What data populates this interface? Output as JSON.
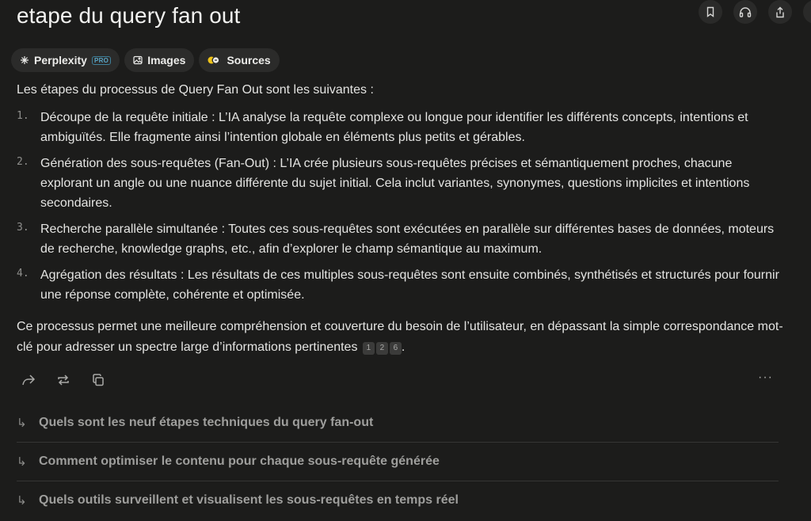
{
  "title": "etape du query fan out",
  "top_actions": [
    {
      "icon": "bookmark-icon"
    },
    {
      "icon": "headphones-icon"
    },
    {
      "icon": "share-icon"
    }
  ],
  "pills": {
    "perplexity": {
      "label": "Perplexity",
      "badge": "PRO"
    },
    "images": {
      "label": "Images"
    },
    "sources": {
      "label": "Sources"
    }
  },
  "answer": {
    "intro": "Les étapes du processus de Query Fan Out sont les suivantes :",
    "steps": [
      {
        "num": "1.",
        "text": "Découpe de la requête initiale : L’IA analyse la requête complexe ou longue pour identifier les différents concepts, intentions et ambiguïtés. Elle fragmente ainsi l’intention globale en éléments plus petits et gérables."
      },
      {
        "num": "2.",
        "text": "Génération des sous-requêtes (Fan-Out) : L’IA crée plusieurs sous-requêtes précises et sémantiquement proches, chacune explorant un angle ou une nuance différente du sujet initial. Cela inclut variantes, synonymes, questions implicites et intentions secondaires."
      },
      {
        "num": "3.",
        "text": "Recherche parallèle simultanée : Toutes ces sous-requêtes sont exécutées en parallèle sur différentes bases de données, moteurs de recherche, knowledge graphs, etc., afin d’explorer le champ sémantique au maximum."
      },
      {
        "num": "4.",
        "text": "Agrégation des résultats : Les résultats de ces multiples sous-requêtes sont ensuite combinés, synthétisés et structurés pour fournir une réponse complète, cohérente et optimisée."
      }
    ],
    "conclusion": "Ce processus permet une meilleure compréhension et couverture du besoin de l’utilisateur, en dépassant la simple correspondance mot-clé pour adresser un spectre large d’informations pertinentes",
    "citations": [
      "1",
      "2",
      "6"
    ],
    "end": "."
  },
  "action_icons": [
    "share-arrow-icon",
    "rewrite-icon",
    "copy-icon"
  ],
  "more_label": "···",
  "related": [
    {
      "arrow": "↳",
      "text": "Quels sont les neuf étapes techniques du query fan-out"
    },
    {
      "arrow": "↳",
      "text": "Comment optimiser le contenu pour chaque sous-requête générée"
    },
    {
      "arrow": "↳",
      "text": "Quels outils surveillent et visualisent les sous-requêtes en temps réel"
    }
  ]
}
